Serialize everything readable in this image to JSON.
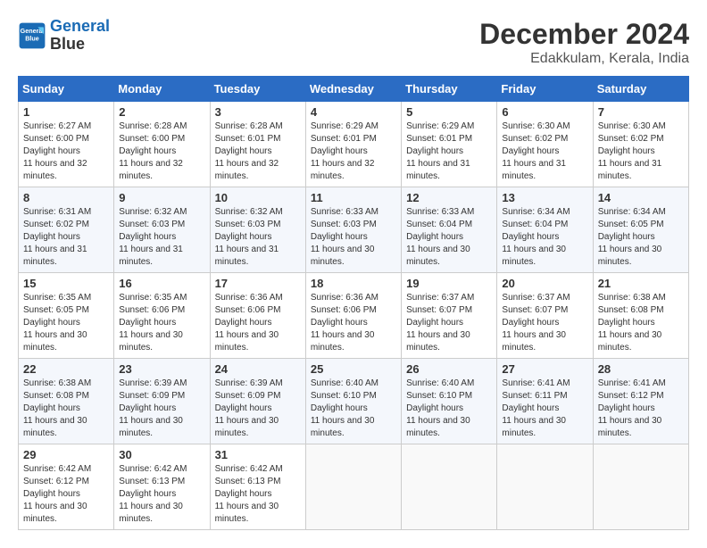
{
  "header": {
    "logo_line1": "General",
    "logo_line2": "Blue",
    "month_year": "December 2024",
    "location": "Edakkulam, Kerala, India"
  },
  "weekdays": [
    "Sunday",
    "Monday",
    "Tuesday",
    "Wednesday",
    "Thursday",
    "Friday",
    "Saturday"
  ],
  "weeks": [
    [
      {
        "day": 1,
        "rise": "6:27 AM",
        "set": "6:00 PM",
        "daylight": "11 hours and 32 minutes."
      },
      {
        "day": 2,
        "rise": "6:28 AM",
        "set": "6:00 PM",
        "daylight": "11 hours and 32 minutes."
      },
      {
        "day": 3,
        "rise": "6:28 AM",
        "set": "6:01 PM",
        "daylight": "11 hours and 32 minutes."
      },
      {
        "day": 4,
        "rise": "6:29 AM",
        "set": "6:01 PM",
        "daylight": "11 hours and 32 minutes."
      },
      {
        "day": 5,
        "rise": "6:29 AM",
        "set": "6:01 PM",
        "daylight": "11 hours and 31 minutes."
      },
      {
        "day": 6,
        "rise": "6:30 AM",
        "set": "6:02 PM",
        "daylight": "11 hours and 31 minutes."
      },
      {
        "day": 7,
        "rise": "6:30 AM",
        "set": "6:02 PM",
        "daylight": "11 hours and 31 minutes."
      }
    ],
    [
      {
        "day": 8,
        "rise": "6:31 AM",
        "set": "6:02 PM",
        "daylight": "11 hours and 31 minutes."
      },
      {
        "day": 9,
        "rise": "6:32 AM",
        "set": "6:03 PM",
        "daylight": "11 hours and 31 minutes."
      },
      {
        "day": 10,
        "rise": "6:32 AM",
        "set": "6:03 PM",
        "daylight": "11 hours and 31 minutes."
      },
      {
        "day": 11,
        "rise": "6:33 AM",
        "set": "6:03 PM",
        "daylight": "11 hours and 30 minutes."
      },
      {
        "day": 12,
        "rise": "6:33 AM",
        "set": "6:04 PM",
        "daylight": "11 hours and 30 minutes."
      },
      {
        "day": 13,
        "rise": "6:34 AM",
        "set": "6:04 PM",
        "daylight": "11 hours and 30 minutes."
      },
      {
        "day": 14,
        "rise": "6:34 AM",
        "set": "6:05 PM",
        "daylight": "11 hours and 30 minutes."
      }
    ],
    [
      {
        "day": 15,
        "rise": "6:35 AM",
        "set": "6:05 PM",
        "daylight": "11 hours and 30 minutes."
      },
      {
        "day": 16,
        "rise": "6:35 AM",
        "set": "6:06 PM",
        "daylight": "11 hours and 30 minutes."
      },
      {
        "day": 17,
        "rise": "6:36 AM",
        "set": "6:06 PM",
        "daylight": "11 hours and 30 minutes."
      },
      {
        "day": 18,
        "rise": "6:36 AM",
        "set": "6:06 PM",
        "daylight": "11 hours and 30 minutes."
      },
      {
        "day": 19,
        "rise": "6:37 AM",
        "set": "6:07 PM",
        "daylight": "11 hours and 30 minutes."
      },
      {
        "day": 20,
        "rise": "6:37 AM",
        "set": "6:07 PM",
        "daylight": "11 hours and 30 minutes."
      },
      {
        "day": 21,
        "rise": "6:38 AM",
        "set": "6:08 PM",
        "daylight": "11 hours and 30 minutes."
      }
    ],
    [
      {
        "day": 22,
        "rise": "6:38 AM",
        "set": "6:08 PM",
        "daylight": "11 hours and 30 minutes."
      },
      {
        "day": 23,
        "rise": "6:39 AM",
        "set": "6:09 PM",
        "daylight": "11 hours and 30 minutes."
      },
      {
        "day": 24,
        "rise": "6:39 AM",
        "set": "6:09 PM",
        "daylight": "11 hours and 30 minutes."
      },
      {
        "day": 25,
        "rise": "6:40 AM",
        "set": "6:10 PM",
        "daylight": "11 hours and 30 minutes."
      },
      {
        "day": 26,
        "rise": "6:40 AM",
        "set": "6:10 PM",
        "daylight": "11 hours and 30 minutes."
      },
      {
        "day": 27,
        "rise": "6:41 AM",
        "set": "6:11 PM",
        "daylight": "11 hours and 30 minutes."
      },
      {
        "day": 28,
        "rise": "6:41 AM",
        "set": "6:12 PM",
        "daylight": "11 hours and 30 minutes."
      }
    ],
    [
      {
        "day": 29,
        "rise": "6:42 AM",
        "set": "6:12 PM",
        "daylight": "11 hours and 30 minutes."
      },
      {
        "day": 30,
        "rise": "6:42 AM",
        "set": "6:13 PM",
        "daylight": "11 hours and 30 minutes."
      },
      {
        "day": 31,
        "rise": "6:42 AM",
        "set": "6:13 PM",
        "daylight": "11 hours and 30 minutes."
      },
      null,
      null,
      null,
      null
    ]
  ]
}
